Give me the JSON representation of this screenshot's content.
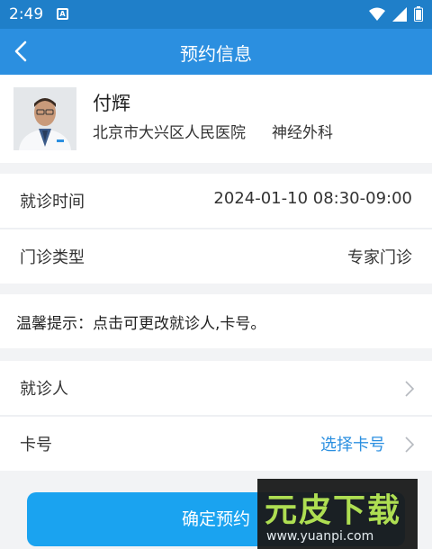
{
  "status_bar": {
    "time": "2:49",
    "notif_label": "A"
  },
  "nav": {
    "title": "预约信息"
  },
  "doctor": {
    "name": "付辉",
    "hospital": "北京市大兴区人民医院",
    "department": "神经外科"
  },
  "appointment": {
    "time_label": "就诊时间",
    "time_value": "2024-01-10 08:30-09:00",
    "type_label": "门诊类型",
    "type_value": "专家门诊"
  },
  "tip": {
    "text": "温馨提示：点击可更改就诊人,卡号。"
  },
  "patient": {
    "patient_label": "就诊人",
    "card_label": "卡号",
    "card_action": "选择卡号"
  },
  "confirm_button": {
    "label": "确定预约"
  },
  "watermark": {
    "brand": "元皮下载",
    "url": "www.yuanpi.com"
  },
  "colors": {
    "status_bar": "#1f7fc9",
    "nav_bar": "#2b8fe0",
    "accent": "#2b8fe0",
    "button": "#1aa3f0"
  }
}
